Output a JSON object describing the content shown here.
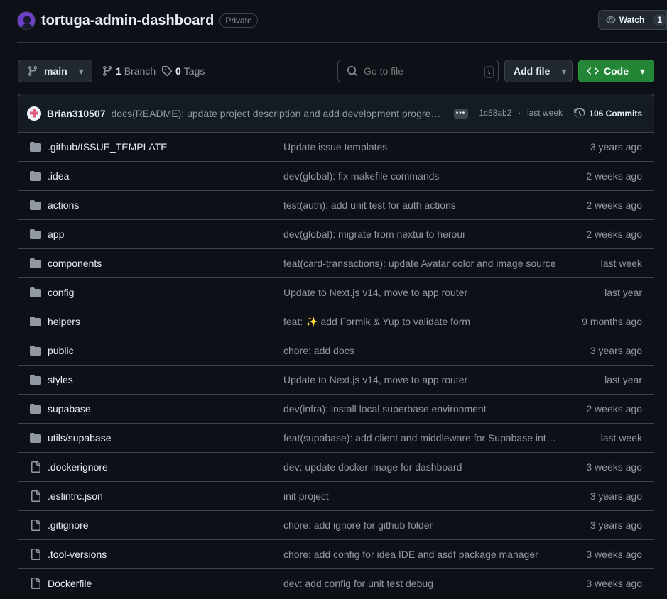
{
  "repo": {
    "name": "tortuga-admin-dashboard",
    "visibility": "Private"
  },
  "watch": {
    "label": "Watch",
    "count": "1"
  },
  "toolbar": {
    "branch_label": "main",
    "branches_count": "1",
    "branches_label": "Branch",
    "tags_count": "0",
    "tags_label": "Tags",
    "search_placeholder": "Go to file",
    "search_shortcut": "t",
    "add_file_label": "Add file",
    "code_label": "Code"
  },
  "latest_commit": {
    "author": "Brian310507",
    "message": "docs(README): update project description and add development progress...",
    "hash": "1c58ab2",
    "when": "last week",
    "commits_label": "106 Commits"
  },
  "files": [
    {
      "type": "folder",
      "name": ".github/ISSUE_TEMPLATE",
      "message": "Update issue templates",
      "when": "3 years ago"
    },
    {
      "type": "folder",
      "name": ".idea",
      "message": "dev(global): fix makefile commands",
      "when": "2 weeks ago"
    },
    {
      "type": "folder",
      "name": "actions",
      "message": "test(auth): add unit test for auth actions",
      "when": "2 weeks ago"
    },
    {
      "type": "folder",
      "name": "app",
      "message": "dev(global): migrate from nextui to heroui",
      "when": "2 weeks ago"
    },
    {
      "type": "folder",
      "name": "components",
      "message": "feat(card-transactions): update Avatar color and image source",
      "when": "last week"
    },
    {
      "type": "folder",
      "name": "config",
      "message": "Update to Next.js v14, move to app router",
      "when": "last year"
    },
    {
      "type": "folder",
      "name": "helpers",
      "message": "feat: ✨ add Formik & Yup to validate form",
      "when": "9 months ago"
    },
    {
      "type": "folder",
      "name": "public",
      "message": "chore: add docs",
      "when": "3 years ago"
    },
    {
      "type": "folder",
      "name": "styles",
      "message": "Update to Next.js v14, move to app router",
      "when": "last year"
    },
    {
      "type": "folder",
      "name": "supabase",
      "message": "dev(infra): install local superbase environment",
      "when": "2 weeks ago"
    },
    {
      "type": "folder",
      "name": "utils/supabase",
      "message": "feat(supabase): add client and middleware for Supabase integration",
      "when": "last week"
    },
    {
      "type": "file",
      "name": ".dockerignore",
      "message": "dev: update docker image for dashboard",
      "when": "3 weeks ago"
    },
    {
      "type": "file",
      "name": ".eslintrc.json",
      "message": "init project",
      "when": "3 years ago"
    },
    {
      "type": "file",
      "name": ".gitignore",
      "message": "chore: add ignore for github folder",
      "when": "3 years ago"
    },
    {
      "type": "file",
      "name": ".tool-versions",
      "message": "chore: add config for idea IDE and asdf package manager",
      "when": "3 weeks ago"
    },
    {
      "type": "file",
      "name": "Dockerfile",
      "message": "dev: add config for unit test debug",
      "when": "3 weeks ago"
    }
  ]
}
